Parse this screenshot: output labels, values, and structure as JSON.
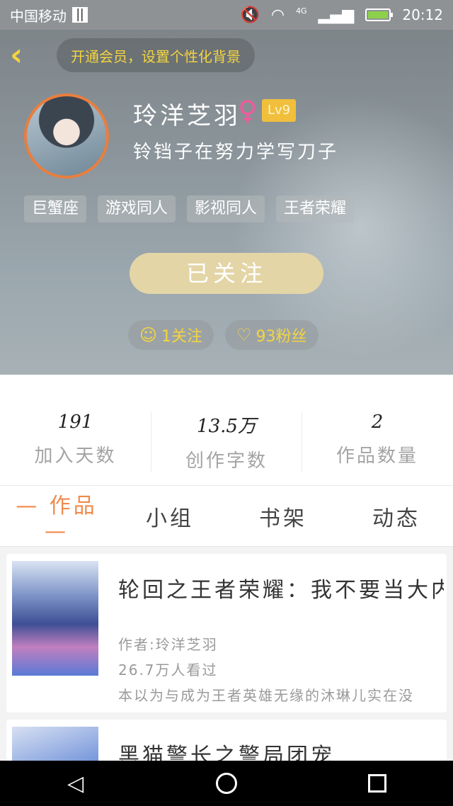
{
  "status_bar": {
    "carrier": "中国移动",
    "network": "4G",
    "time": "20:12"
  },
  "header": {
    "vip_banner": "开通会员，设置个性化背景"
  },
  "profile": {
    "name": "玲洋芝羽",
    "gender_symbol": "♀",
    "level": "Lv9",
    "signature": "铃铛子在努力学写刀子",
    "tags": [
      "巨蟹座",
      "游戏同人",
      "影视同人",
      "王者荣耀"
    ],
    "follow_button": "已关注",
    "following": "1关注",
    "fans": "93粉丝"
  },
  "stats": [
    {
      "value": "191",
      "label": "加入天数"
    },
    {
      "value": "13.5万",
      "label": "创作字数"
    },
    {
      "value": "2",
      "label": "作品数量"
    }
  ],
  "tabs": [
    {
      "label": "— 作品 —",
      "active": true
    },
    {
      "label": "小组",
      "active": false
    },
    {
      "label": "书架",
      "active": false
    },
    {
      "label": "动态",
      "active": false
    }
  ],
  "works": [
    {
      "title": "轮回之王者荣耀：我不要当大内",
      "author": "作者:玲洋芝羽",
      "views": "26.7万人看过",
      "summary": "本以为与成为王者英雄无缘的沐琳儿实在没"
    },
    {
      "title": "黑猫警长之警局团宠"
    }
  ],
  "colors": {
    "accent": "#f08a4b",
    "gold": "#f4d43f",
    "follow_button": "#e3d5a6"
  }
}
